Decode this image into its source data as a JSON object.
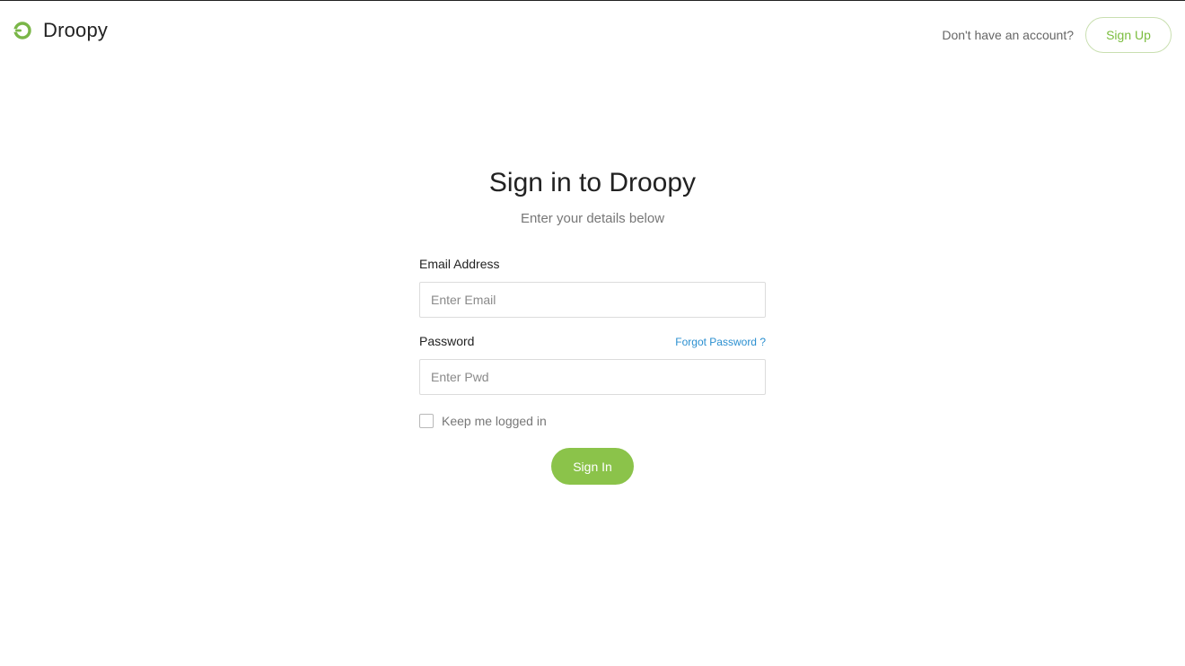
{
  "header": {
    "brand_name": "Droopy",
    "account_prompt": "Don't have an account?",
    "signup_label": "Sign Up"
  },
  "form": {
    "title": "Sign in to Droopy",
    "subtitle": "Enter your details below",
    "email_label": "Email Address",
    "email_placeholder": "Enter Email",
    "email_value": "",
    "password_label": "Password",
    "forgot_label": "Forgot Password ?",
    "password_placeholder": "Enter Pwd",
    "password_value": "",
    "keep_logged_label": "Keep me logged in",
    "keep_logged_checked": false,
    "signin_label": "Sign In"
  },
  "icons": {
    "brand_logo": "droopy-logo-icon"
  },
  "colors": {
    "accent": "#8bc34a",
    "link": "#2a8fd0",
    "text": "#222222",
    "muted": "#777777"
  }
}
